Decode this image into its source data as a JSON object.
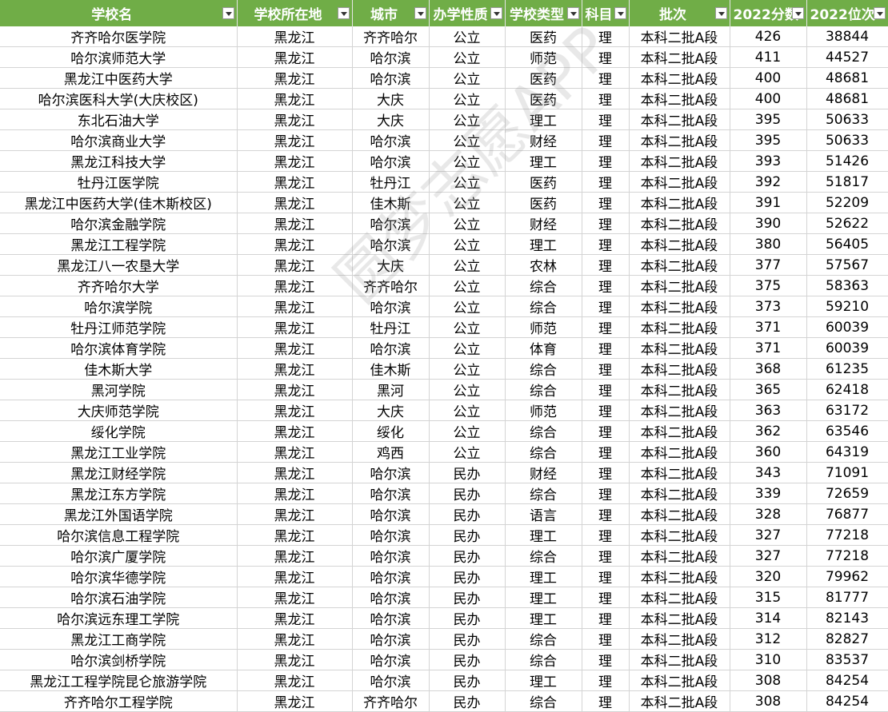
{
  "headers": [
    "学校名",
    "学校所在地",
    "城市",
    "办学性质",
    "学校类型",
    "科目",
    "批次",
    "2022分数",
    "2022位次"
  ],
  "rows": [
    [
      "齐齐哈尔医学院",
      "黑龙江",
      "齐齐哈尔",
      "公立",
      "医药",
      "理",
      "本科二批A段",
      "426",
      "38844"
    ],
    [
      "哈尔滨师范大学",
      "黑龙江",
      "哈尔滨",
      "公立",
      "师范",
      "理",
      "本科二批A段",
      "411",
      "44527"
    ],
    [
      "黑龙江中医药大学",
      "黑龙江",
      "哈尔滨",
      "公立",
      "医药",
      "理",
      "本科二批A段",
      "400",
      "48681"
    ],
    [
      "哈尔滨医科大学(大庆校区)",
      "黑龙江",
      "大庆",
      "公立",
      "医药",
      "理",
      "本科二批A段",
      "400",
      "48681"
    ],
    [
      "东北石油大学",
      "黑龙江",
      "大庆",
      "公立",
      "理工",
      "理",
      "本科二批A段",
      "395",
      "50633"
    ],
    [
      "哈尔滨商业大学",
      "黑龙江",
      "哈尔滨",
      "公立",
      "财经",
      "理",
      "本科二批A段",
      "395",
      "50633"
    ],
    [
      "黑龙江科技大学",
      "黑龙江",
      "哈尔滨",
      "公立",
      "理工",
      "理",
      "本科二批A段",
      "393",
      "51426"
    ],
    [
      "牡丹江医学院",
      "黑龙江",
      "牡丹江",
      "公立",
      "医药",
      "理",
      "本科二批A段",
      "392",
      "51817"
    ],
    [
      "黑龙江中医药大学(佳木斯校区)",
      "黑龙江",
      "佳木斯",
      "公立",
      "医药",
      "理",
      "本科二批A段",
      "391",
      "52209"
    ],
    [
      "哈尔滨金融学院",
      "黑龙江",
      "哈尔滨",
      "公立",
      "财经",
      "理",
      "本科二批A段",
      "390",
      "52622"
    ],
    [
      "黑龙江工程学院",
      "黑龙江",
      "哈尔滨",
      "公立",
      "理工",
      "理",
      "本科二批A段",
      "380",
      "56405"
    ],
    [
      "黑龙江八一农垦大学",
      "黑龙江",
      "大庆",
      "公立",
      "农林",
      "理",
      "本科二批A段",
      "377",
      "57567"
    ],
    [
      "齐齐哈尔大学",
      "黑龙江",
      "齐齐哈尔",
      "公立",
      "综合",
      "理",
      "本科二批A段",
      "375",
      "58363"
    ],
    [
      "哈尔滨学院",
      "黑龙江",
      "哈尔滨",
      "公立",
      "综合",
      "理",
      "本科二批A段",
      "373",
      "59210"
    ],
    [
      "牡丹江师范学院",
      "黑龙江",
      "牡丹江",
      "公立",
      "师范",
      "理",
      "本科二批A段",
      "371",
      "60039"
    ],
    [
      "哈尔滨体育学院",
      "黑龙江",
      "哈尔滨",
      "公立",
      "体育",
      "理",
      "本科二批A段",
      "371",
      "60039"
    ],
    [
      "佳木斯大学",
      "黑龙江",
      "佳木斯",
      "公立",
      "综合",
      "理",
      "本科二批A段",
      "368",
      "61235"
    ],
    [
      "黑河学院",
      "黑龙江",
      "黑河",
      "公立",
      "综合",
      "理",
      "本科二批A段",
      "365",
      "62418"
    ],
    [
      "大庆师范学院",
      "黑龙江",
      "大庆",
      "公立",
      "师范",
      "理",
      "本科二批A段",
      "363",
      "63172"
    ],
    [
      "绥化学院",
      "黑龙江",
      "绥化",
      "公立",
      "综合",
      "理",
      "本科二批A段",
      "362",
      "63546"
    ],
    [
      "黑龙江工业学院",
      "黑龙江",
      "鸡西",
      "公立",
      "综合",
      "理",
      "本科二批A段",
      "360",
      "64319"
    ],
    [
      "黑龙江财经学院",
      "黑龙江",
      "哈尔滨",
      "民办",
      "财经",
      "理",
      "本科二批A段",
      "343",
      "71091"
    ],
    [
      "黑龙江东方学院",
      "黑龙江",
      "哈尔滨",
      "民办",
      "综合",
      "理",
      "本科二批A段",
      "339",
      "72659"
    ],
    [
      "黑龙江外国语学院",
      "黑龙江",
      "哈尔滨",
      "民办",
      "语言",
      "理",
      "本科二批A段",
      "328",
      "76877"
    ],
    [
      "哈尔滨信息工程学院",
      "黑龙江",
      "哈尔滨",
      "民办",
      "理工",
      "理",
      "本科二批A段",
      "327",
      "77218"
    ],
    [
      "哈尔滨广厦学院",
      "黑龙江",
      "哈尔滨",
      "民办",
      "综合",
      "理",
      "本科二批A段",
      "327",
      "77218"
    ],
    [
      "哈尔滨华德学院",
      "黑龙江",
      "哈尔滨",
      "民办",
      "理工",
      "理",
      "本科二批A段",
      "320",
      "79962"
    ],
    [
      "哈尔滨石油学院",
      "黑龙江",
      "哈尔滨",
      "民办",
      "理工",
      "理",
      "本科二批A段",
      "315",
      "81777"
    ],
    [
      "哈尔滨远东理工学院",
      "黑龙江",
      "哈尔滨",
      "民办",
      "理工",
      "理",
      "本科二批A段",
      "314",
      "82143"
    ],
    [
      "黑龙江工商学院",
      "黑龙江",
      "哈尔滨",
      "民办",
      "综合",
      "理",
      "本科二批A段",
      "312",
      "82827"
    ],
    [
      "哈尔滨剑桥学院",
      "黑龙江",
      "哈尔滨",
      "民办",
      "综合",
      "理",
      "本科二批A段",
      "310",
      "83537"
    ],
    [
      "黑龙江工程学院昆仑旅游学院",
      "黑龙江",
      "哈尔滨",
      "民办",
      "理工",
      "理",
      "本科二批A段",
      "308",
      "84254"
    ],
    [
      "齐齐哈尔工程学院",
      "黑龙江",
      "齐齐哈尔",
      "民办",
      "综合",
      "理",
      "本科二批A段",
      "308",
      "84254"
    ]
  ],
  "watermark": "圆梦志愿APP",
  "colors": {
    "header_bg": "#70ad47",
    "header_text": "#ffffff",
    "grid": "#d4d4d4"
  },
  "icons": {
    "filter": "filter-dropdown-icon"
  }
}
